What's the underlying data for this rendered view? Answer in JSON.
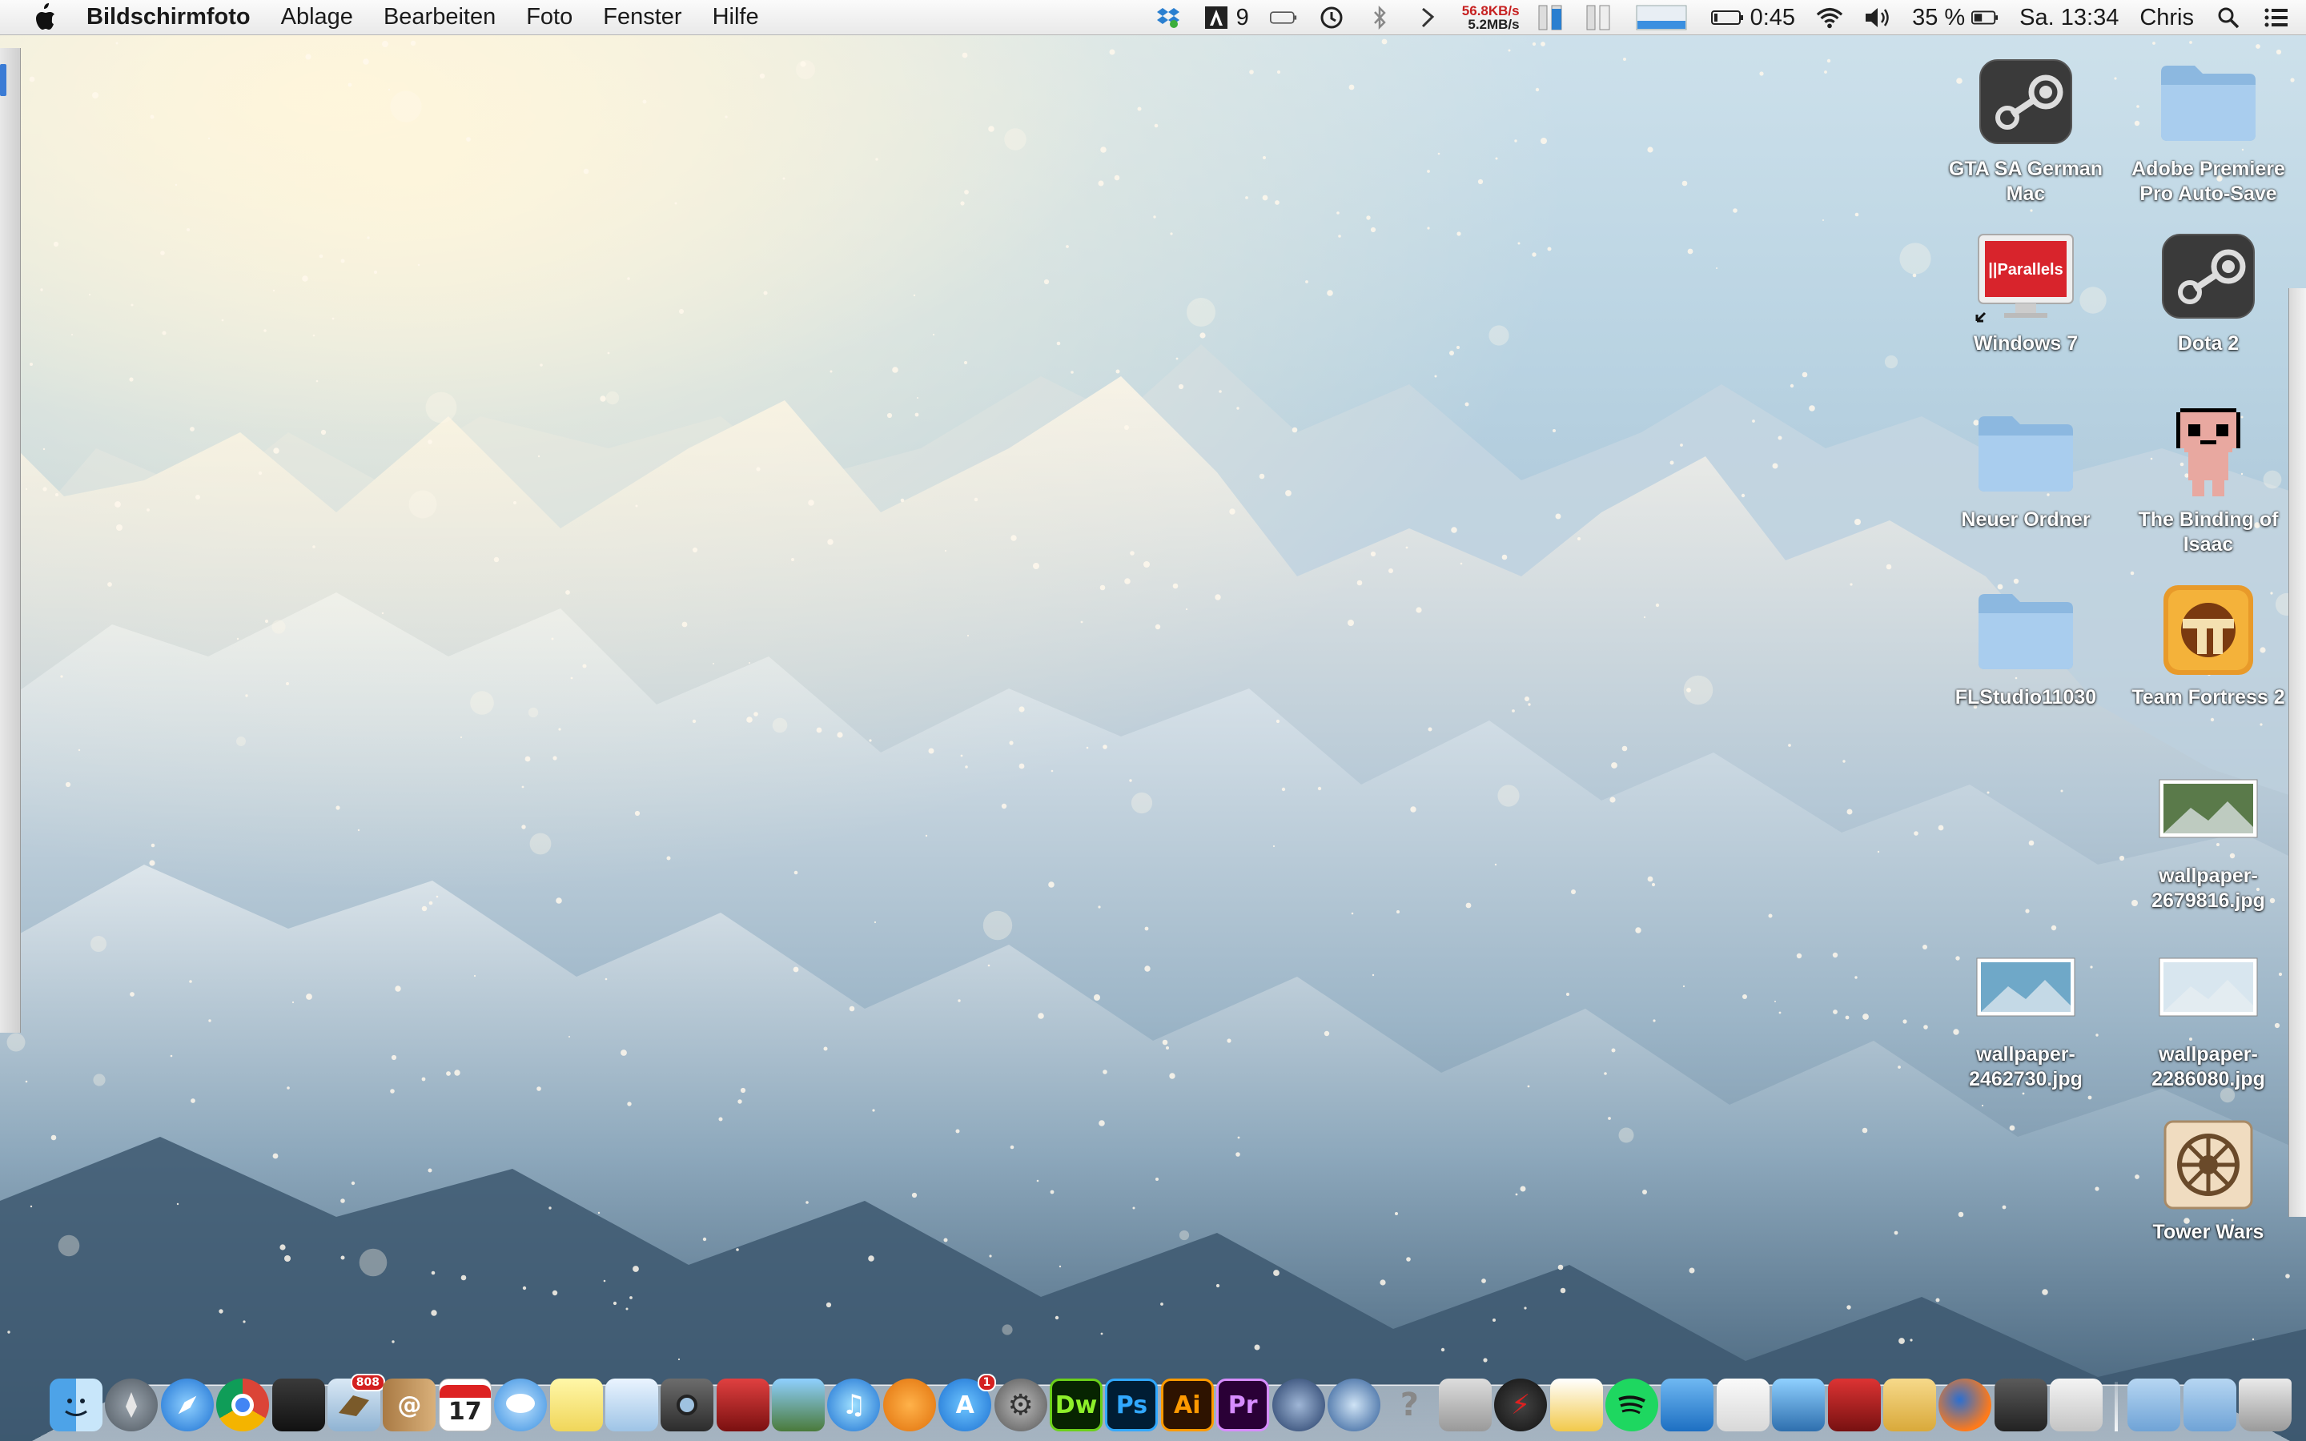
{
  "menubar": {
    "app_name": "Bildschirmfoto",
    "menus": [
      "Ablage",
      "Bearbeiten",
      "Foto",
      "Fenster",
      "Hilfe"
    ],
    "status": {
      "adobe_count": "9",
      "net_up": "56.8KB/s",
      "net_down": "5.2MB/s",
      "battery_time": "0:45",
      "volume_percent": "35 %",
      "clock": "Sa. 13:34",
      "user": "Chris"
    }
  },
  "desktop_icons": [
    {
      "label": "GTA SA German Mac",
      "icon": "steam-icon"
    },
    {
      "label": "Adobe Premiere Pro Auto-Save",
      "icon": "folder-icon"
    },
    {
      "label": "Windows 7",
      "icon": "parallels-icon"
    },
    {
      "label": "Dota 2",
      "icon": "steam-icon"
    },
    {
      "label": "Neuer Ordner",
      "icon": "folder-icon"
    },
    {
      "label": "The Binding of Isaac",
      "icon": "isaac-icon"
    },
    {
      "label": "FLStudio11030",
      "icon": "folder-icon"
    },
    {
      "label": "Team Fortress 2",
      "icon": "tf2-icon"
    },
    {
      "label": "wallpaper-2679816.jpg",
      "icon": "image-thumb-icon"
    },
    {
      "label": "wallpaper-2462730.jpg",
      "icon": "image-thumb-icon"
    },
    {
      "label": "wallpaper-2286080.jpg",
      "icon": "image-thumb-icon"
    },
    {
      "label": "Tower Wars",
      "icon": "tower-wars-icon"
    }
  ],
  "dock": {
    "calendar_day": "17",
    "mail_badge": "808",
    "appstore_badge": "1",
    "dw_label": "Dw",
    "ps_label": "Ps",
    "ai_label": "Ai",
    "pr_label": "Pr"
  },
  "colors": {
    "menubar_bg": "#eeeeee",
    "net_up": "#c62020",
    "label_text": "#ffffff"
  }
}
